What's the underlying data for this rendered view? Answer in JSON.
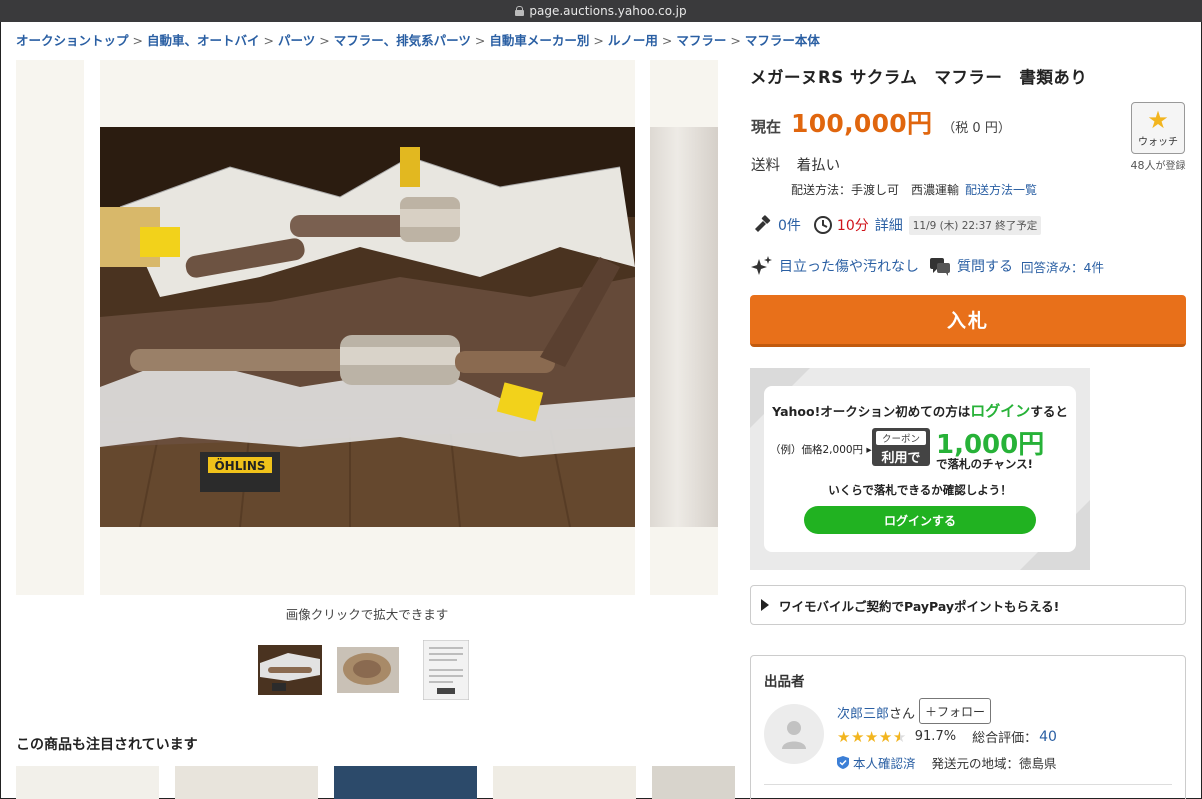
{
  "browser": {
    "url": "page.auctions.yahoo.co.jp"
  },
  "breadcrumb": [
    "オークショントップ",
    "自動車、オートバイ",
    "パーツ",
    "マフラー、排気系パーツ",
    "自動車メーカー別",
    "ルノー用",
    "マフラー",
    "マフラー本体"
  ],
  "breadcrumb_separator": ">",
  "gallery": {
    "caption": "画像クリックで拡大できます",
    "thumbnails": [
      "thumbnail-1",
      "thumbnail-2",
      "thumbnail-3"
    ]
  },
  "recommend": {
    "title": "この商品も注目されています"
  },
  "item": {
    "title": "メガーヌRS サクラム　マフラー　書類あり",
    "price_label": "現在",
    "price": "100,000円",
    "tax": "（税 0 円）",
    "shipping_label": "送料",
    "shipping_value": "着払い",
    "shipping_method": "配送方法：手渡し可　西濃運輸",
    "shipping_link": "配送方法一覧",
    "bids": "0件",
    "time_left": "10分",
    "detail_link": "詳細",
    "end_time": "11/9 (木) 22:37 終了予定",
    "condition": "目立った傷や汚れなし",
    "question_link": "質問する",
    "answered": "回答済み：4件"
  },
  "watch": {
    "label": "ウォッチ",
    "count": "48人",
    "count_suffix": "が登録",
    "icon": "star-icon"
  },
  "bid_button": "入札",
  "promo": {
    "line_pre": "Yahoo!オークション初めての方は",
    "line_highlight": "ログイン",
    "line_post": "すると",
    "example": "（例）価格2,000円 ▸",
    "coupon_top": "クーポン",
    "coupon_bottom": "利用で",
    "amount": "1,000円",
    "amount_sub": "で落札のチャンス!",
    "check": "いくらで落札できるか確認しよう！",
    "login_button": "ログインする"
  },
  "ymobile": {
    "text": "ワイモバイルご契約でPayPayポイントもらえる!"
  },
  "seller": {
    "heading": "出品者",
    "name": "次郎三郎",
    "name_suffix": "さん",
    "follow": "＋フォロー",
    "stars": "★★★★★",
    "rating_stars": 4.5,
    "percent": "91.7%",
    "total_label": "総合評価：",
    "total_value": "40",
    "verified": "本人確認済",
    "region": "発送元の地域：徳島県"
  },
  "colors": {
    "accent": "#e8701a",
    "price": "#e0660e",
    "link": "#2a5fa3",
    "green": "#27b238",
    "timer": "#d0131a"
  }
}
